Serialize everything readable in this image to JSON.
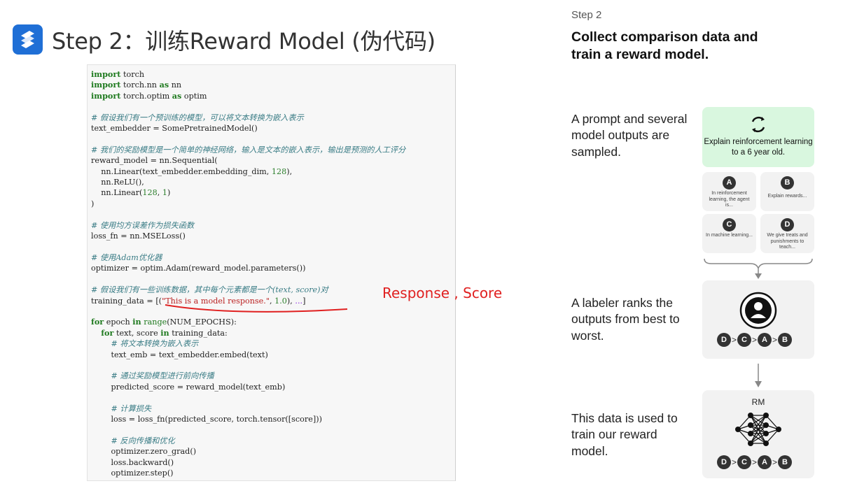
{
  "header": {
    "title": "Step 2：训练Reward Model (伪代码)"
  },
  "code_lines": [
    [
      {
        "t": "import",
        "c": "kw"
      },
      {
        "t": " torch"
      }
    ],
    [
      {
        "t": "import",
        "c": "kw"
      },
      {
        "t": " torch.nn "
      },
      {
        "t": "as",
        "c": "kw"
      },
      {
        "t": " nn"
      }
    ],
    [
      {
        "t": "import",
        "c": "kw"
      },
      {
        "t": " torch.optim "
      },
      {
        "t": "as",
        "c": "kw"
      },
      {
        "t": " optim"
      }
    ],
    [],
    [
      {
        "t": "# 假设我们有一个预训练的模型，可以将文本转换为嵌入表示",
        "c": "cm"
      }
    ],
    [
      {
        "t": "text_embedder = SomePretrainedModel()"
      }
    ],
    [],
    [
      {
        "t": "# 我们的奖励模型是一个简单的神经网络，输入是文本的嵌入表示，输出是预测的人工评分",
        "c": "cm"
      }
    ],
    [
      {
        "t": "reward_model = nn.Sequential("
      }
    ],
    [
      {
        "t": "    nn.Linear(text_embedder.embedding_dim, "
      },
      {
        "t": "128",
        "c": "num"
      },
      {
        "t": "),"
      }
    ],
    [
      {
        "t": "    nn.ReLU(),"
      }
    ],
    [
      {
        "t": "    nn.Linear("
      },
      {
        "t": "128",
        "c": "num"
      },
      {
        "t": ", "
      },
      {
        "t": "1",
        "c": "num"
      },
      {
        "t": ")"
      }
    ],
    [
      {
        "t": ")"
      }
    ],
    [],
    [
      {
        "t": "# 使用均方误差作为损失函数",
        "c": "cm"
      }
    ],
    [
      {
        "t": "loss_fn = nn.MSELoss()"
      }
    ],
    [],
    [
      {
        "t": "# 使用Adam优化器",
        "c": "cm"
      }
    ],
    [
      {
        "t": "optimizer = optim.Adam(reward_model.parameters())"
      }
    ],
    [],
    [
      {
        "t": "# 假设我们有一些训练数据，其中每个元素都是一个(text, score)对",
        "c": "cm"
      }
    ],
    [
      {
        "t": "training_data = [("
      },
      {
        "t": "\"This is a model response.\"",
        "c": "str"
      },
      {
        "t": ", "
      },
      {
        "t": "1.0",
        "c": "num"
      },
      {
        "t": "), "
      },
      {
        "t": "...",
        "c": "ell"
      },
      {
        "t": "]"
      }
    ],
    [],
    [
      {
        "t": "for",
        "c": "kw"
      },
      {
        "t": " epoch "
      },
      {
        "t": "in",
        "c": "kw"
      },
      {
        "t": " "
      },
      {
        "t": "range",
        "c": "bi"
      },
      {
        "t": "(NUM_EPOCHS):"
      }
    ],
    [
      {
        "t": "    "
      },
      {
        "t": "for",
        "c": "kw"
      },
      {
        "t": " text, score "
      },
      {
        "t": "in",
        "c": "kw"
      },
      {
        "t": " training_data:"
      }
    ],
    [
      {
        "t": "        "
      },
      {
        "t": "# 将文本转换为嵌入表示",
        "c": "cm"
      }
    ],
    [
      {
        "t": "        text_emb = text_embedder.embed(text)"
      }
    ],
    [],
    [
      {
        "t": "        "
      },
      {
        "t": "# 通过奖励模型进行前向传播",
        "c": "cm"
      }
    ],
    [
      {
        "t": "        predicted_score = reward_model(text_emb)"
      }
    ],
    [],
    [
      {
        "t": "        "
      },
      {
        "t": "# 计算损失",
        "c": "cm"
      }
    ],
    [
      {
        "t": "        loss = loss_fn(predicted_score, torch.tensor([score]))"
      }
    ],
    [],
    [
      {
        "t": "        "
      },
      {
        "t": "# 反向传播和优化",
        "c": "cm"
      }
    ],
    [
      {
        "t": "        optimizer.zero_grad()"
      }
    ],
    [
      {
        "t": "        loss.backward()"
      }
    ],
    [
      {
        "t": "        optimizer.step()"
      }
    ]
  ],
  "annotation": "Response , Score",
  "diagram": {
    "step_label": "Step 2",
    "heading": "Collect comparison data and train a reward model.",
    "desc1": "A prompt and several model outputs are sampled.",
    "desc2": "A labeler ranks the outputs from best to worst.",
    "desc3": "This data is used to train our reward model.",
    "prompt": "Explain reinforcement learning to a 6 year old.",
    "options": [
      {
        "letter": "A",
        "text": "In reinforcement learning, the agent is..."
      },
      {
        "letter": "B",
        "text": "Explain rewards..."
      },
      {
        "letter": "C",
        "text": "In machine learning..."
      },
      {
        "letter": "D",
        "text": "We give treats and punishments to teach..."
      }
    ],
    "ranking": [
      "D",
      "C",
      "A",
      "B"
    ],
    "rm_label": "RM"
  },
  "colors": {
    "accent": "#1f6fd6",
    "annotation": "#e02020",
    "prompt_bg": "#d9f7df"
  }
}
